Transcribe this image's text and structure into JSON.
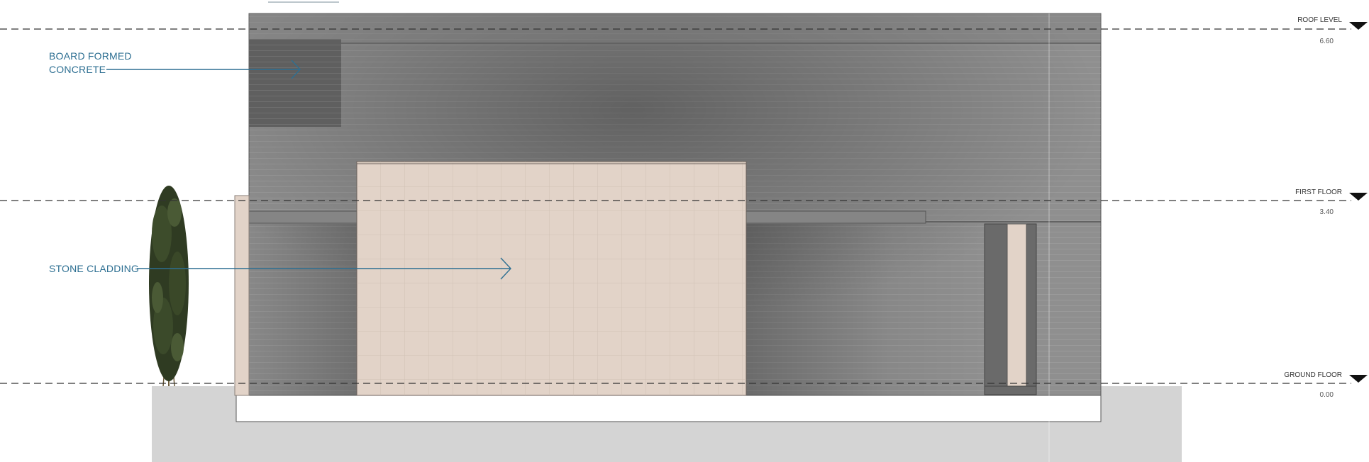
{
  "annotations": {
    "board_formed_concrete": [
      "BOARD FORMED",
      "CONCRETE"
    ],
    "stone_cladding": "STONE CLADDING"
  },
  "levels": [
    {
      "name": "ROOF LEVEL",
      "value": "6.60"
    },
    {
      "name": "FIRST FLOOR",
      "value": "3.40"
    },
    {
      "name": "GROUND FLOOR",
      "value": "0.00"
    }
  ],
  "colors": {
    "annotation": "#2d6f92",
    "concrete": "#8f8f8f",
    "stone": "#e2d3c8",
    "ground": "#d4d4d4",
    "tree": "#2f3b22"
  }
}
